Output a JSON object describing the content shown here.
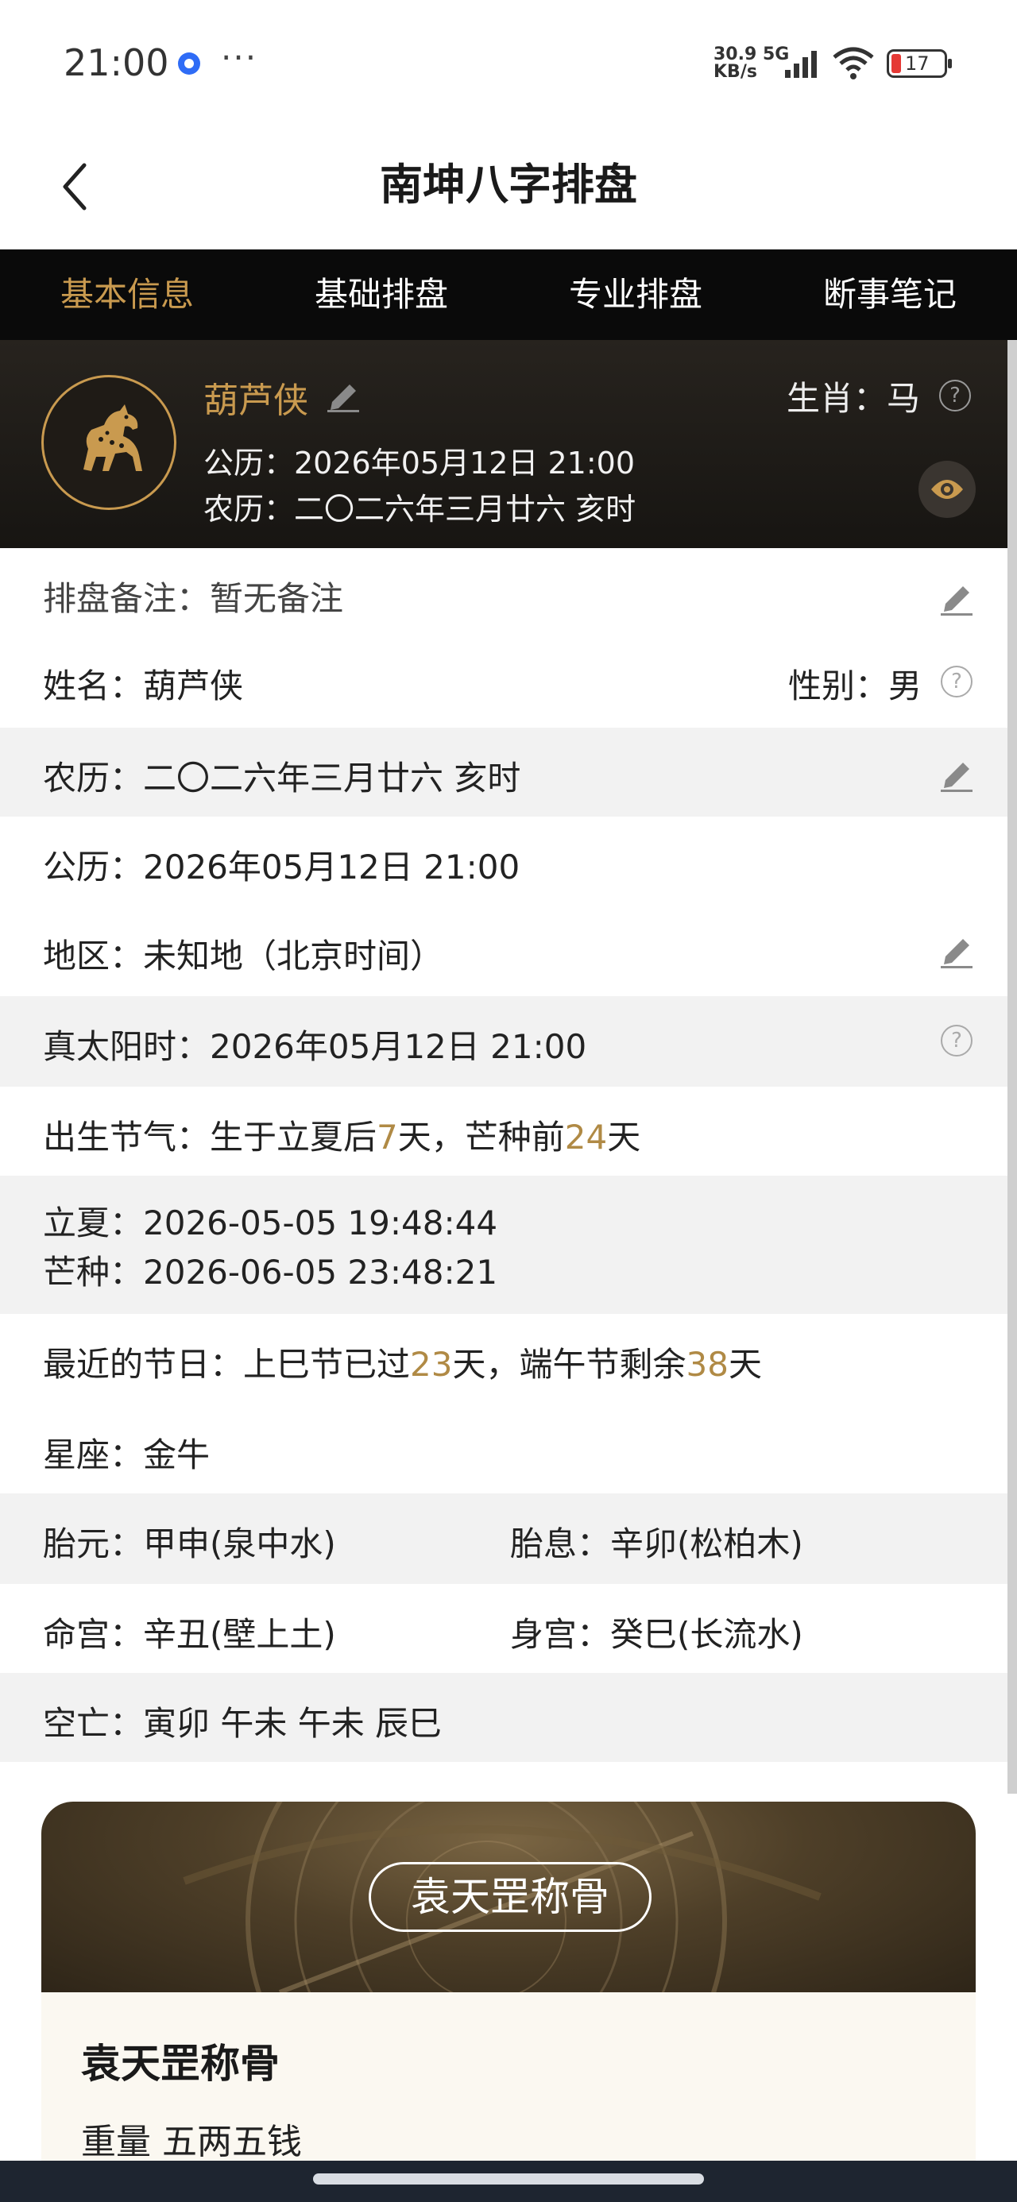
{
  "status": {
    "time": "21:00",
    "more": "···",
    "net_speed_top": "30.9 5G",
    "net_speed_bottom": "KB/s",
    "battery": "17"
  },
  "header": {
    "title": "南坤八字排盘"
  },
  "tabs": [
    {
      "label": "基本信息",
      "active": true
    },
    {
      "label": "基础排盘",
      "active": false
    },
    {
      "label": "专业排盘",
      "active": false
    },
    {
      "label": "断事笔记",
      "active": false
    }
  ],
  "profile": {
    "name": "葫芦侠",
    "zodiac": "生肖：马",
    "solar": "公历：2026年05月12日 21:00",
    "lunar": "农历：二〇二六年三月廿六  亥时"
  },
  "info": {
    "note": "排盘备注：暂无备注",
    "name": "姓名：葫芦侠",
    "gender": "性别：男",
    "lunar": "农历：二〇二六年三月廿六  亥时",
    "solar": "公历：2026年05月12日 21:00",
    "region": "地区：未知地（北京时间）",
    "true_solar": "真太阳时：2026年05月12日 21:00",
    "solar_term": {
      "prefix": "出生节气：生于立夏后",
      "days_after": "7",
      "mid": "天，芒种前",
      "days_before": "24",
      "suffix": "天"
    },
    "lixia": "立夏：2026-05-05 19:48:44",
    "mangzhong": "芒种：2026-06-05 23:48:21",
    "festival": {
      "prefix": "最近的节日：上巳节已过",
      "days_past": "23",
      "mid": "天，端午节剩余",
      "days_left": "38",
      "suffix": "天"
    },
    "constellation": "星座：金牛",
    "taiyuan": "胎元：甲申(泉中水)",
    "taixi": "胎息：辛卯(松柏木)",
    "minggong": "命宫：辛丑(壁上土)",
    "shengong": "身宫：癸巳(长流水)",
    "kongwang": "空亡：寅卯 午未 午未 辰巳"
  },
  "card": {
    "banner_label": "袁天罡称骨",
    "title": "袁天罡称骨",
    "weight": "重量  五两五钱"
  },
  "colors": {
    "accent": "#c99a4f",
    "gold_text": "#b08a45",
    "tab_bg": "#0a0a0a"
  }
}
